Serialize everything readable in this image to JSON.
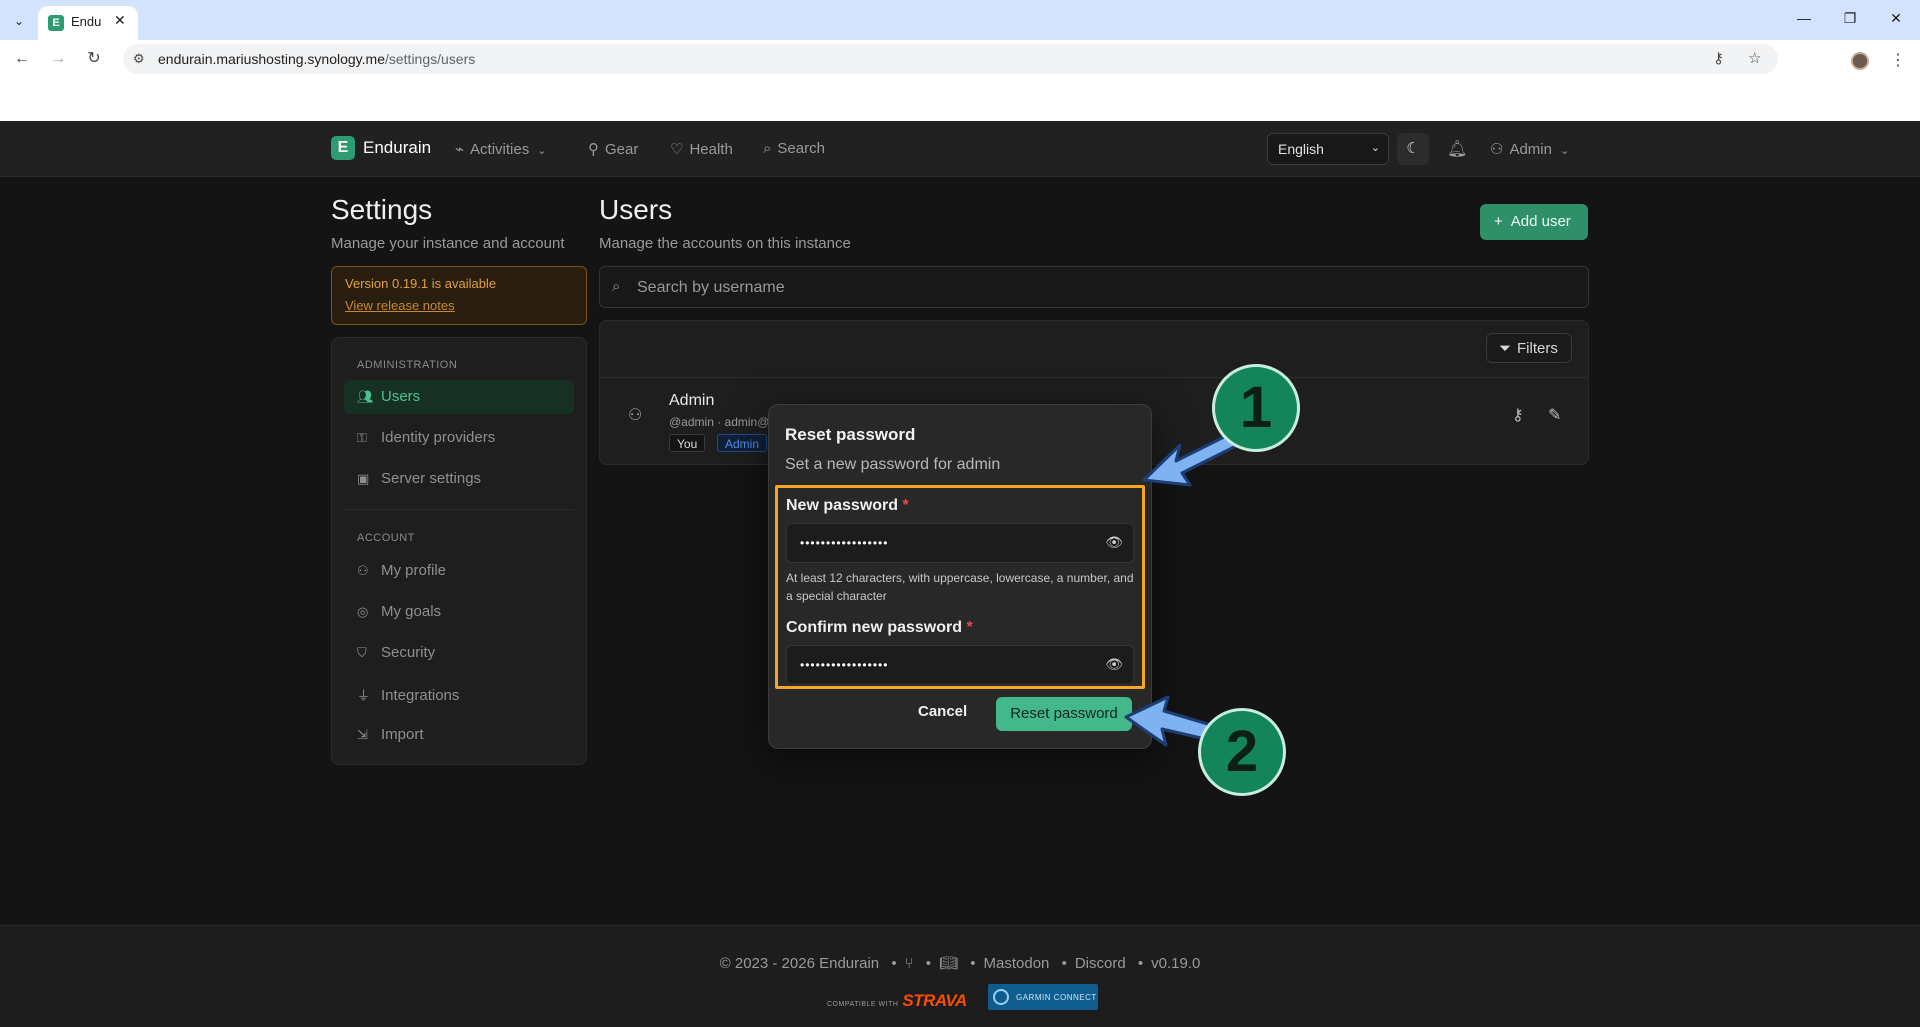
{
  "browser": {
    "tab_title": "Endurain",
    "url_host": "endurain.mariushosting.synology.me",
    "url_path": "/settings/users"
  },
  "header": {
    "brand": "Endurain",
    "nav": [
      {
        "label": "Activities",
        "icon": "activity-icon"
      },
      {
        "label": "Gear",
        "icon": "bike-icon"
      },
      {
        "label": "Health",
        "icon": "heart-icon"
      },
      {
        "label": "Search",
        "icon": "search-icon"
      }
    ],
    "language": "English",
    "user": "Admin"
  },
  "settings": {
    "title": "Settings",
    "subtitle": "Manage your instance and account",
    "version_notice": "Version 0.19.1 is available",
    "release_notes": "View release notes",
    "sections": [
      {
        "heading": "ADMINISTRATION",
        "items": [
          {
            "label": "Users",
            "icon": "users-icon",
            "active": true
          },
          {
            "label": "Identity providers",
            "icon": "key-icon"
          },
          {
            "label": "Server settings",
            "icon": "server-icon"
          }
        ]
      },
      {
        "heading": "ACCOUNT",
        "items": [
          {
            "label": "My profile",
            "icon": "user-icon"
          },
          {
            "label": "My goals",
            "icon": "target-icon"
          },
          {
            "label": "Security",
            "icon": "shield-icon"
          },
          {
            "label": "Integrations",
            "icon": "plug-icon"
          },
          {
            "label": "Import",
            "icon": "import-icon"
          }
        ]
      }
    ]
  },
  "users": {
    "title": "Users",
    "subtitle": "Manage the accounts on this instance",
    "add_user": "Add user",
    "search_placeholder": "Search by username",
    "filters": "Filters",
    "rows": [
      {
        "name": "Admin",
        "meta": "@admin · admin@",
        "badges": [
          "You",
          "Admin"
        ]
      }
    ]
  },
  "modal": {
    "title": "Reset password",
    "subtitle": "Set a new password for admin",
    "new_password_label": "New password",
    "new_password_value": "•••••••••••••••••",
    "hint": "At least 12 characters, with uppercase, lowercase, a number, and a special character",
    "confirm_label": "Confirm new password",
    "confirm_value": "•••••••••••••••••",
    "required_mark": "*",
    "cancel": "Cancel",
    "submit": "Reset password"
  },
  "annotations": {
    "step1": "1",
    "step2": "2",
    "highlight_color": "#f5a623",
    "arrow_color": "#7fb2f0",
    "callout_color": "#14855b"
  },
  "footer": {
    "copyright": "© 2023 - 2026 Endurain",
    "links": [
      "Mastodon",
      "Discord"
    ],
    "version": "v0.19.0",
    "strava_prefix": "COMPATIBLE WITH",
    "strava": "STRAVA",
    "garmin": "GARMIN CONNECT"
  }
}
